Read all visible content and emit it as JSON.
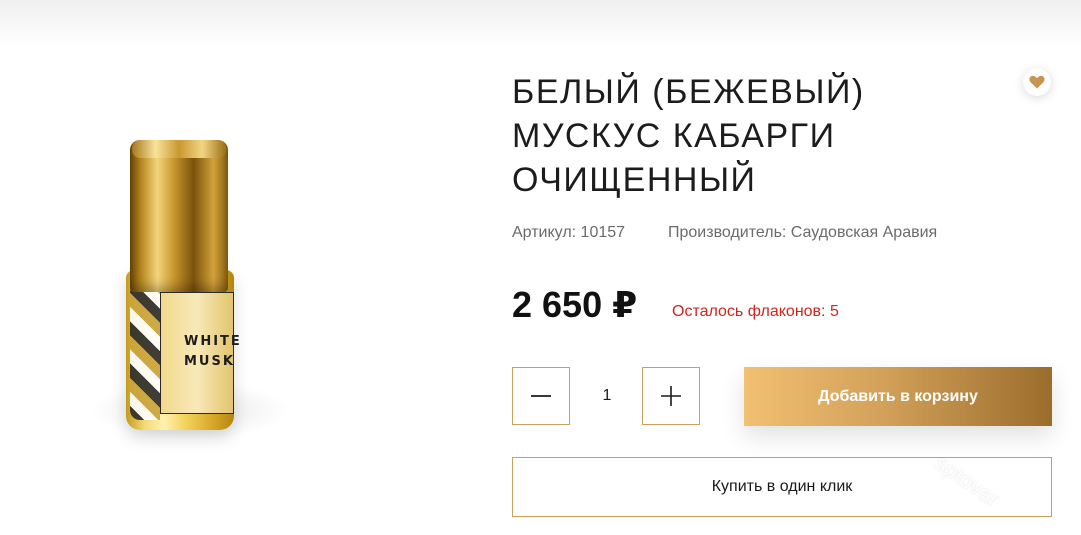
{
  "product": {
    "title_lines": [
      "БЕЛЫЙ (БЕЖЕВЫЙ)",
      "МУСКУС КАБАРГИ",
      "ОЧИЩЕННЫЙ"
    ],
    "article": "Артикул: 10157",
    "manufacturer": "Производитель: Саудовская Аравия",
    "price": "2 650 ₽",
    "stock": "Осталось флаконов: 5",
    "image_label": "WHITE\nMUSK"
  },
  "controls": {
    "quantity": "1",
    "minus_icon": "minus-icon",
    "plus_icon": "plus-icon",
    "add_to_cart": "Добавить в корзину",
    "buy_one_click": "Купить в один клик",
    "favorite_icon": "heart-icon"
  },
  "watermark": "sptovar",
  "colors": {
    "accent_gold": "#c9a15c",
    "stock_red": "#d3241c",
    "heart": "#c9944f"
  }
}
